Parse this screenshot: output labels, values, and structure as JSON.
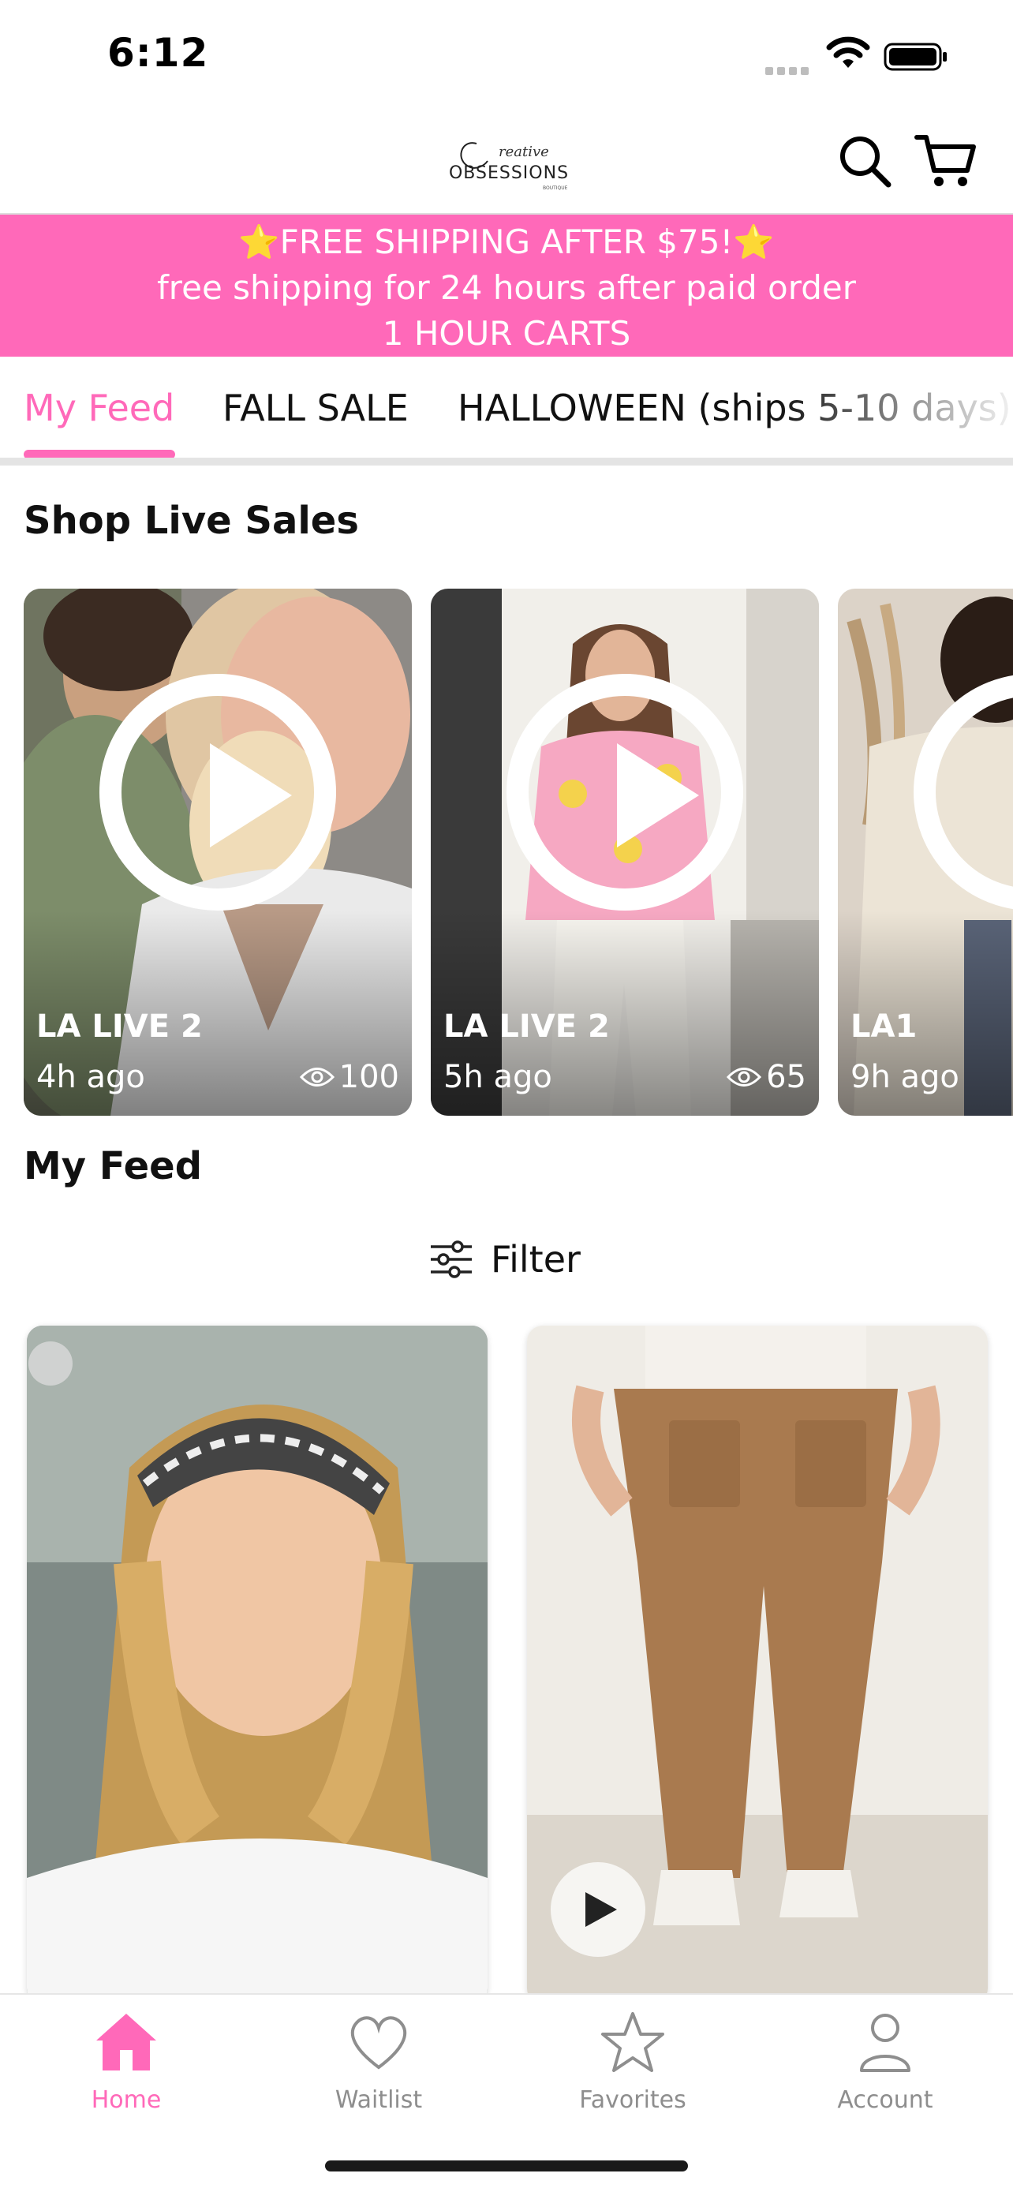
{
  "status_bar": {
    "time": "6:12"
  },
  "header": {
    "logo_script": "Creative",
    "logo_text": "OBSESSIONS",
    "logo_sub": "BOUTIQUE"
  },
  "promo": {
    "line1": "FREE SHIPPING AFTER $75!",
    "line1_star": "⭐",
    "line2": "free shipping for 24 hours after paid order",
    "line3": "1 HOUR CARTS",
    "bg_color": "#ff69b9"
  },
  "tabs": [
    {
      "label": "My Feed",
      "active": true
    },
    {
      "label": "FALL SALE",
      "active": false
    },
    {
      "label": "HALLOWEEN (ships 5-10 days)",
      "active": false
    }
  ],
  "live_section": {
    "title": "Shop Live Sales",
    "cards": [
      {
        "name": "LA LIVE 2",
        "time": "4h ago",
        "views": "100"
      },
      {
        "name": "LA LIVE 2",
        "time": "5h ago",
        "views": "65"
      },
      {
        "name": "LA1",
        "time": "9h ago",
        "views": ""
      }
    ]
  },
  "feed_section": {
    "title": "My Feed",
    "filter_label": "Filter"
  },
  "products": [
    {
      "name": "Plaid headband",
      "has_video": false
    },
    {
      "name": "Cargo pants",
      "has_video": true
    }
  ],
  "bottom_nav": [
    {
      "label": "Home",
      "icon": "home-icon",
      "active": true
    },
    {
      "label": "Waitlist",
      "icon": "heart-icon",
      "active": false
    },
    {
      "label": "Favorites",
      "icon": "star-icon",
      "active": false
    },
    {
      "label": "Account",
      "icon": "person-icon",
      "active": false
    }
  ],
  "accent_color": "#ff69b9"
}
